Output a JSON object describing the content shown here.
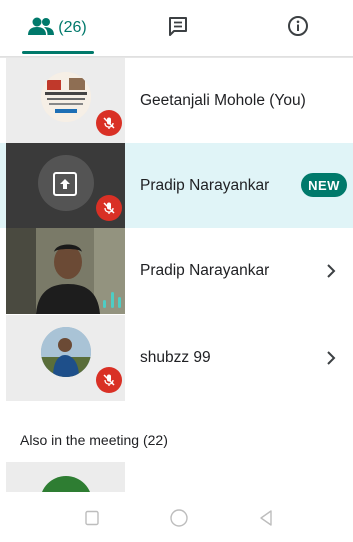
{
  "tabs": {
    "people_count": "(26)",
    "active_color": "#00796b"
  },
  "participants": [
    {
      "name": "Geetanjali Mohole (You)",
      "muted": true
    },
    {
      "name": "Pradip Narayankar",
      "badge": "NEW",
      "muted": true,
      "presenting": true
    },
    {
      "name": "Pradip Narayankar",
      "speaking": true
    },
    {
      "name": "shubzz 99",
      "muted": true
    }
  ],
  "section": {
    "also_in_meeting": "Also in the meeting (22)"
  },
  "colors": {
    "accent": "#00796b",
    "highlight_row": "#e0f4f7",
    "mute_red": "#d93025"
  }
}
